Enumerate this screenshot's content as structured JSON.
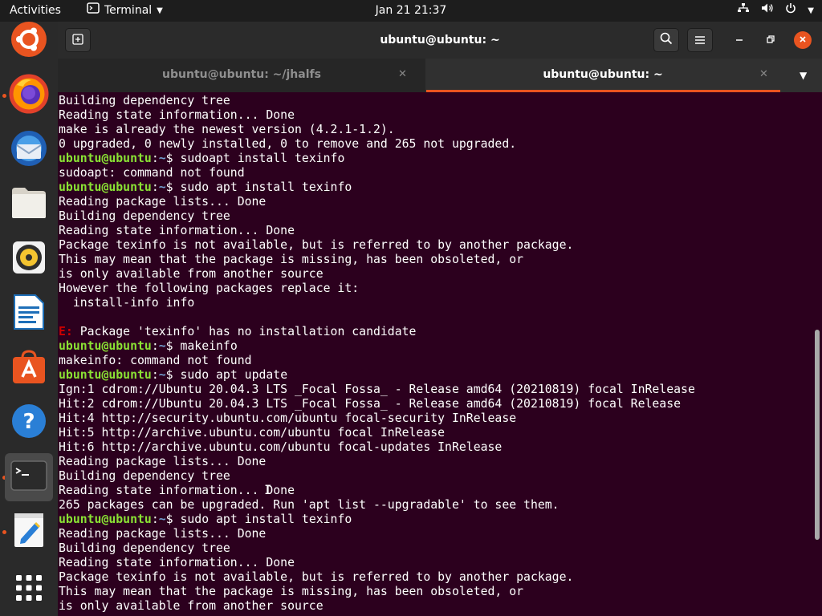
{
  "topbar": {
    "activities": "Activities",
    "app_name": "Terminal",
    "clock": "Jan 21  21:37"
  },
  "dock": {
    "items": [
      {
        "name": "ubuntu-logo-icon"
      },
      {
        "name": "firefox-icon"
      },
      {
        "name": "thunderbird-icon"
      },
      {
        "name": "files-icon"
      },
      {
        "name": "rhythmbox-icon"
      },
      {
        "name": "libreoffice-writer-icon"
      },
      {
        "name": "ubuntu-software-icon"
      },
      {
        "name": "help-icon"
      },
      {
        "name": "terminal-icon"
      },
      {
        "name": "text-editor-icon"
      },
      {
        "name": "show-applications-icon"
      }
    ]
  },
  "window": {
    "title": "ubuntu@ubuntu: ~",
    "tabs": [
      {
        "label": "ubuntu@ubuntu: ~/jhalfs",
        "active": false
      },
      {
        "label": "ubuntu@ubuntu: ~",
        "active": true
      }
    ],
    "accent": "#e95420"
  },
  "terminal": {
    "user_host": "ubuntu@ubuntu",
    "path": "~",
    "background": "#2c001e",
    "lines": [
      {
        "type": "out",
        "text": "Building dependency tree"
      },
      {
        "type": "out",
        "text": "Reading state information... Done"
      },
      {
        "type": "out",
        "text": "make is already the newest version (4.2.1-1.2)."
      },
      {
        "type": "out",
        "text": "0 upgraded, 0 newly installed, 0 to remove and 265 not upgraded."
      },
      {
        "type": "cmd",
        "text": "sudoapt install texinfo"
      },
      {
        "type": "out",
        "text": "sudoapt: command not found"
      },
      {
        "type": "cmd",
        "text": "sudo apt install texinfo"
      },
      {
        "type": "out",
        "text": "Reading package lists... Done"
      },
      {
        "type": "out",
        "text": "Building dependency tree"
      },
      {
        "type": "out",
        "text": "Reading state information... Done"
      },
      {
        "type": "out",
        "text": "Package texinfo is not available, but is referred to by another package."
      },
      {
        "type": "out",
        "text": "This may mean that the package is missing, has been obsoleted, or"
      },
      {
        "type": "out",
        "text": "is only available from another source"
      },
      {
        "type": "out",
        "text": "However the following packages replace it:"
      },
      {
        "type": "out",
        "text": "  install-info info"
      },
      {
        "type": "out",
        "text": ""
      },
      {
        "type": "err",
        "label": "E:",
        "text": " Package 'texinfo' has no installation candidate"
      },
      {
        "type": "cmd",
        "text": "makeinfo"
      },
      {
        "type": "out",
        "text": "makeinfo: command not found"
      },
      {
        "type": "cmd",
        "text": "sudo apt update"
      },
      {
        "type": "out",
        "text": "Ign:1 cdrom://Ubuntu 20.04.3 LTS _Focal Fossa_ - Release amd64 (20210819) focal InRelease"
      },
      {
        "type": "out",
        "text": "Hit:2 cdrom://Ubuntu 20.04.3 LTS _Focal Fossa_ - Release amd64 (20210819) focal Release"
      },
      {
        "type": "out",
        "text": "Hit:4 http://security.ubuntu.com/ubuntu focal-security InRelease"
      },
      {
        "type": "out",
        "text": "Hit:5 http://archive.ubuntu.com/ubuntu focal InRelease"
      },
      {
        "type": "out",
        "text": "Hit:6 http://archive.ubuntu.com/ubuntu focal-updates InRelease"
      },
      {
        "type": "out",
        "text": "Reading package lists... Done"
      },
      {
        "type": "out",
        "text": "Building dependency tree"
      },
      {
        "type": "out",
        "text": "Reading state information... Done"
      },
      {
        "type": "out",
        "text": "265 packages can be upgraded. Run 'apt list --upgradable' to see them."
      },
      {
        "type": "cmd",
        "text": "sudo apt install texinfo"
      },
      {
        "type": "out",
        "text": "Reading package lists... Done"
      },
      {
        "type": "out",
        "text": "Building dependency tree"
      },
      {
        "type": "out",
        "text": "Reading state information... Done"
      },
      {
        "type": "out",
        "text": "Package texinfo is not available, but is referred to by another package."
      },
      {
        "type": "out",
        "text": "This may mean that the package is missing, has been obsoleted, or"
      },
      {
        "type": "out",
        "text": "is only available from another source"
      }
    ]
  }
}
